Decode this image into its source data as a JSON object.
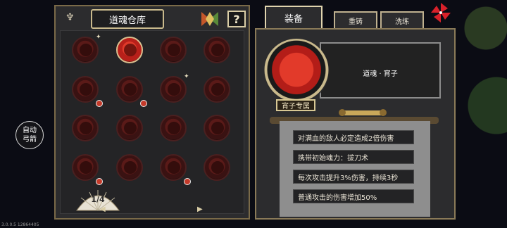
{
  "side_button": {
    "label": "自动\n弓箭"
  },
  "version": "3.0.0.5 12864405",
  "left_panel": {
    "title": "道魂仓库",
    "page": "1/4",
    "souls": [
      {
        "selected": false,
        "badge": "star"
      },
      {
        "selected": true,
        "badge": ""
      },
      {
        "selected": false,
        "badge": ""
      },
      {
        "selected": false,
        "badge": ""
      },
      {
        "selected": false,
        "badge": "dot"
      },
      {
        "selected": false,
        "badge": "dot"
      },
      {
        "selected": false,
        "badge": "star"
      },
      {
        "selected": false,
        "badge": ""
      },
      {
        "selected": false,
        "badge": ""
      },
      {
        "selected": false,
        "badge": ""
      },
      {
        "selected": false,
        "badge": ""
      },
      {
        "selected": false,
        "badge": ""
      },
      {
        "selected": false,
        "badge": "dot"
      },
      {
        "selected": false,
        "badge": ""
      },
      {
        "selected": false,
        "badge": "dot"
      },
      {
        "selected": false,
        "badge": ""
      }
    ]
  },
  "right_panel": {
    "tabs": [
      "装备",
      "重铸",
      "洗练"
    ],
    "soul_name": "道魂 · 宵子",
    "tag": "宵子专属",
    "effects": [
      "对满血的敌人必定造成2倍伤害",
      "携带初始魂力：拔刀术",
      "每次攻击提升3%伤害，持续3秒",
      "普通攻击的伤害增加50%"
    ]
  },
  "colors": {
    "accent_gold": "#c9b98c",
    "soul_red": "#b8201a"
  }
}
